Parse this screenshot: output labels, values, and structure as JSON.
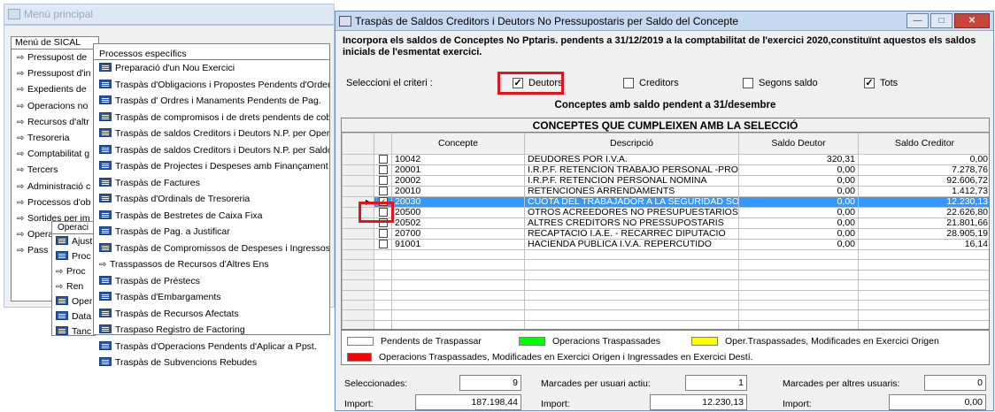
{
  "bg": {
    "title": "Menú principal",
    "menu_header": "Menú de SICAL",
    "menu_items": [
      "Pressupost de",
      "Pressupost d'in",
      "Expedients de",
      "Operacions no",
      "Recursos d'altr",
      "Tresoreria",
      "Comptabilitat g",
      "Tercers",
      "Administració c",
      "Processos d'ob",
      "Sortides per im",
      "Operacions de",
      "Pass"
    ],
    "proc_header": "Processos específics",
    "proc_items": [
      {
        "icon": "table",
        "label": "Preparació d'un Nou Exercici"
      },
      {
        "icon": "table",
        "label": "Traspàs d'Obligacions i Propostes Pendents d'Ordenar"
      },
      {
        "icon": "table",
        "label": "Traspàs d' Ordres i Manaments Pendents de Pag."
      },
      {
        "icon": "table",
        "label": "Traspàs de compromisos i de drets pendents de cobram"
      },
      {
        "icon": "table",
        "label": "Traspàs de saldos Creditors i Deutors N.P. per Operació"
      },
      {
        "icon": "table",
        "label": "Traspàs de saldos Creditors i Deutors N.P. per Saldo de"
      },
      {
        "icon": "table",
        "label": "Traspàs de Projectes i Despeses amb Finançament Afe"
      },
      {
        "icon": "table",
        "label": "Traspàs de Factures"
      },
      {
        "icon": "table",
        "label": "Traspàs d'Ordinals de Tresoreria"
      },
      {
        "icon": "table",
        "label": "Traspàs de Bestretes de Caixa Fixa"
      },
      {
        "icon": "table",
        "label": "Traspàs de Pag. a Justificar"
      },
      {
        "icon": "table",
        "label": "Traspàs de Compromissos de Despeses i Ingressos Plu"
      },
      {
        "icon": "arrow",
        "label": "Trasspassos de Recursos d'Altres Ens"
      },
      {
        "icon": "table",
        "label": "Traspàs de Préstecs"
      },
      {
        "icon": "table",
        "label": "Traspàs d'Embargaments"
      },
      {
        "icon": "table",
        "label": "Traspàs de Recursos Afectats"
      },
      {
        "icon": "table",
        "label": "Traspaso Registro de Factoring"
      },
      {
        "icon": "table",
        "label": "Traspàs d'Operacions Pendents d'Aplicar a Ppst."
      },
      {
        "icon": "table",
        "label": "Traspàs de Subvencions Rebudes"
      }
    ],
    "oper_header": "Operaci",
    "oper_items": [
      {
        "icon": "table",
        "label": "Ajust"
      },
      {
        "icon": "table",
        "label": "Proc"
      },
      {
        "icon": "arrow",
        "label": "Proc"
      },
      {
        "icon": "arrow",
        "label": "Ren"
      },
      {
        "icon": "table",
        "label": "Oper"
      },
      {
        "icon": "table",
        "label": "Data"
      },
      {
        "icon": "table",
        "label": "Tanc"
      }
    ]
  },
  "window": {
    "title": "Traspàs de Saldos Creditors i Deutors No Pressupostaris per Saldo del Concepte",
    "description": "Incorpora els saldos de Conceptes No Pptaris. pendents a 31/12/2019 a la comptabilitat de l'exercici 2020,constituïnt aquestos els saldos inicials de l'esmentat exercici.",
    "criteria_label": "Seleccioni el criteri :",
    "criteria": [
      {
        "label": "Deutors",
        "checked": true
      },
      {
        "label": "Creditors",
        "checked": false
      },
      {
        "label": "Segons saldo",
        "checked": false
      },
      {
        "label": "Tots",
        "checked": true
      }
    ],
    "section_title": "Conceptes amb saldo pendent a 31/desembre",
    "grid_caption": "CONCEPTES QUE CUMPLEIXEN AMB LA SELECCIÓ",
    "columns": [
      "Concepte",
      "Descripció",
      "Saldo Deutor",
      "Saldo Creditor"
    ],
    "rows": [
      {
        "concepte": "10042",
        "descripcio": "DEUDORES POR I.V.A.",
        "deutor": "320,31",
        "creditor": "0,00",
        "checked": false,
        "selected": false
      },
      {
        "concepte": "20001",
        "descripcio": "I.R.P.F. RETENCION TRABAJO PERSONAL -PROI",
        "deutor": "0,00",
        "creditor": "7.278,76",
        "checked": false,
        "selected": false
      },
      {
        "concepte": "20002",
        "descripcio": "I.R.P.F. RETENCION PERSONAL NÓMINA",
        "deutor": "0,00",
        "creditor": "92.606,72",
        "checked": false,
        "selected": false
      },
      {
        "concepte": "20010",
        "descripcio": "RETENCIONES ARRENDAMENTS",
        "deutor": "0,00",
        "creditor": "1.412,73",
        "checked": false,
        "selected": false
      },
      {
        "concepte": "20030",
        "descripcio": "CUOTA DEL TRABAJADOR A LA SEGURIDAD SO",
        "deutor": "0,00",
        "creditor": "12.230,13",
        "checked": true,
        "selected": true
      },
      {
        "concepte": "20500",
        "descripcio": "OTROS ACREEDORES NO PRESUPUESTARIOS",
        "deutor": "0,00",
        "creditor": "22.626,80",
        "checked": false,
        "selected": false
      },
      {
        "concepte": "20502",
        "descripcio": "ALTRES CREDITORS NO PRESSUPOSTARIS",
        "deutor": "0,00",
        "creditor": "21.801,66",
        "checked": false,
        "selected": false
      },
      {
        "concepte": "20700",
        "descripcio": "RECAPTACIÓ I.A.E. - RECÀRREC DIPUTACIÓ",
        "deutor": "0,00",
        "creditor": "28.905,19",
        "checked": false,
        "selected": false
      },
      {
        "concepte": "91001",
        "descripcio": "HACIENDA PUBLICA I.V.A. REPERCUTIDO",
        "deutor": "0,00",
        "creditor": "16,14",
        "checked": false,
        "selected": false
      }
    ],
    "legend": [
      {
        "color": "#ffffff",
        "label": "Pendents de Traspassar"
      },
      {
        "color": "#00ff00",
        "label": "Operacions Traspassades"
      },
      {
        "color": "#ffff00",
        "label": "Oper.Traspassades, Modificades en Exercici Origen"
      },
      {
        "color": "#ff0000",
        "label": "Operacions Traspassades, Modificades en Exercici Origen i Ingressades en Exercici Destí."
      }
    ],
    "footer": {
      "selected_label": "Seleccionades:",
      "selected_value": "9",
      "import_label": "Import:",
      "import_value": "187.198,44",
      "active_label": "Marcades per usuari actiu:",
      "active_value": "1",
      "active_import_value": "12.230,13",
      "others_label": "Marcades per altres usuaris:",
      "others_value": "0",
      "others_import_value": "0,00"
    }
  }
}
